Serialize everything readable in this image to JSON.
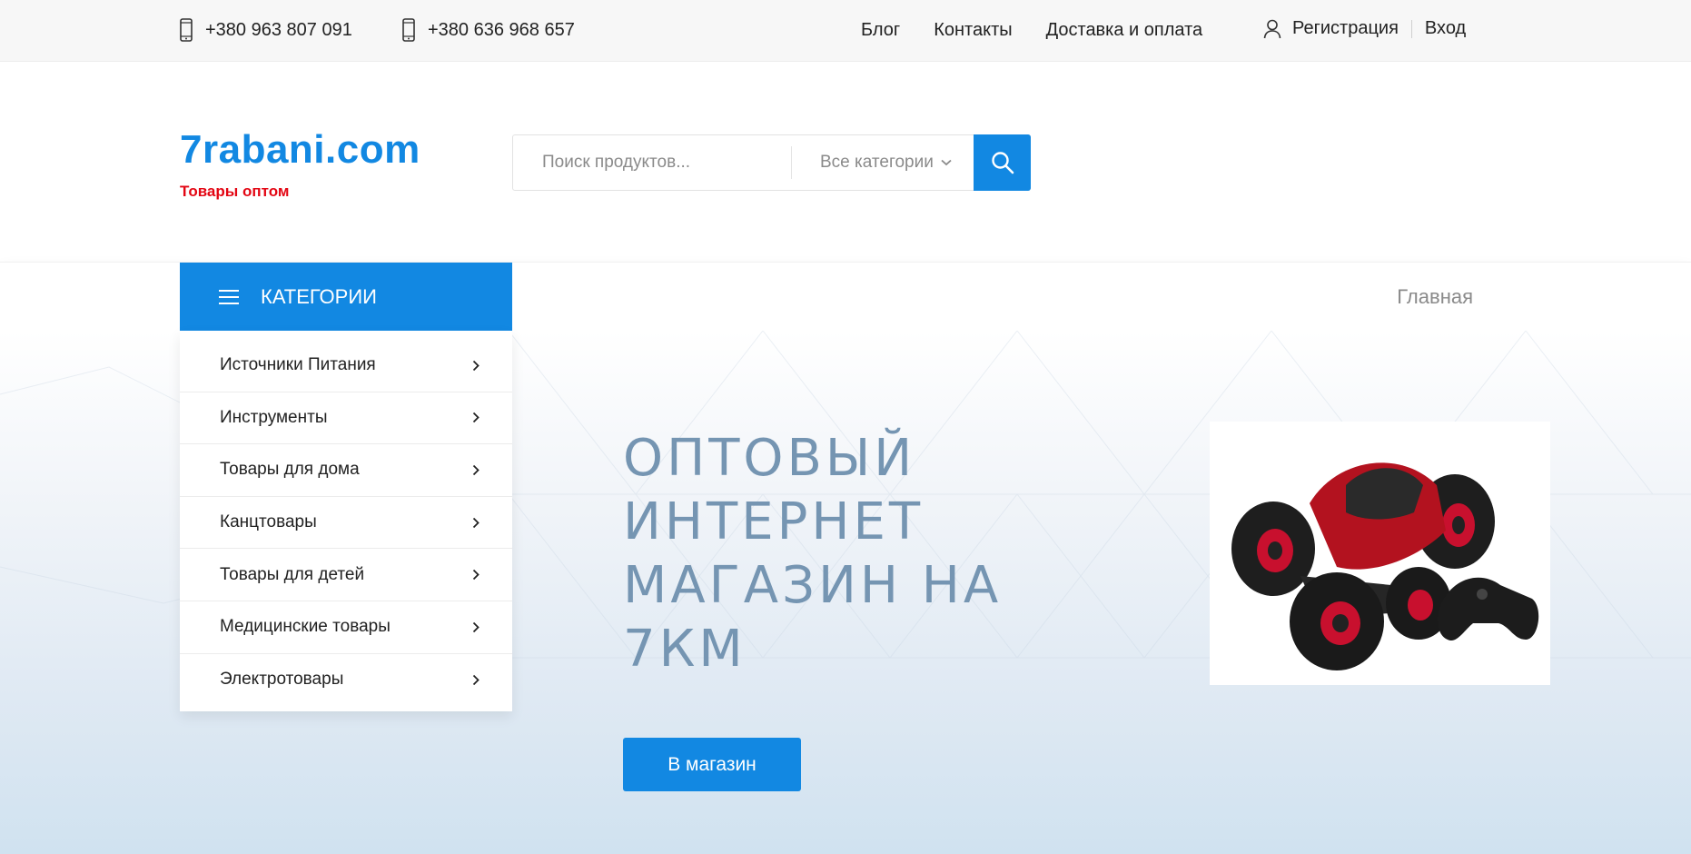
{
  "topbar": {
    "phones": [
      "+380 963 807 091",
      "+380 636 968 657"
    ],
    "links": [
      "Блог",
      "Контакты",
      "Доставка и оплата"
    ],
    "register": "Регистрация",
    "login": "Вход"
  },
  "header": {
    "logo": "7rabani.com",
    "tagline": "Товары оптом",
    "search_placeholder": "Поиск продуктов...",
    "category_select": "Все категории"
  },
  "nav": {
    "categories_button": "КАТЕГОРИИ",
    "home": "Главная"
  },
  "categories": [
    "Источники Питания",
    "Инструменты",
    "Товары для дома",
    "Канцтовары",
    "Товары для детей",
    "Медицинские товары",
    "Электротовары"
  ],
  "hero": {
    "title": "ОПТОВЫЙ ИНТЕРНЕТ МАГАЗИН НА 7КМ",
    "button": "В магазин"
  },
  "colors": {
    "accent": "#1288e2",
    "tagline": "#e30613",
    "hero_title": "#7595b2"
  }
}
